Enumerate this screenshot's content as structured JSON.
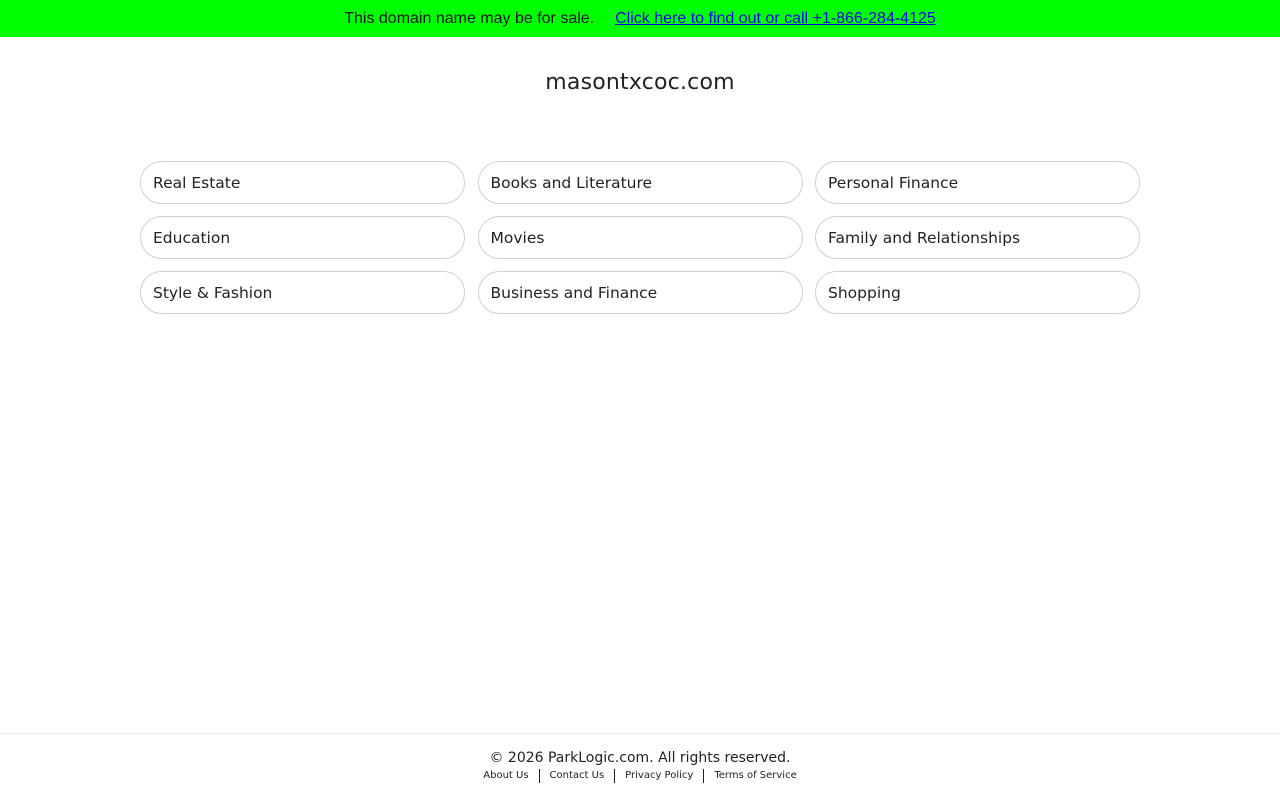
{
  "banner": {
    "text": "This domain name may be for sale.",
    "link_text": "Click here to find out or call +1-866-284-4125",
    "background": "#00ff00",
    "link_color": "#0000ee"
  },
  "domain": "masontxcoc.com",
  "related_links": [
    "Real Estate",
    "Books and Literature",
    "Personal Finance",
    "Education",
    "Movies",
    "Family and Relationships",
    "Style & Fashion",
    "Business and Finance",
    "Shopping"
  ],
  "footer": {
    "copyright": "© 2026 ParkLogic.com. All rights reserved.",
    "links": [
      "About Us",
      "Contact Us",
      "Privacy Policy",
      "Terms of Service"
    ]
  }
}
